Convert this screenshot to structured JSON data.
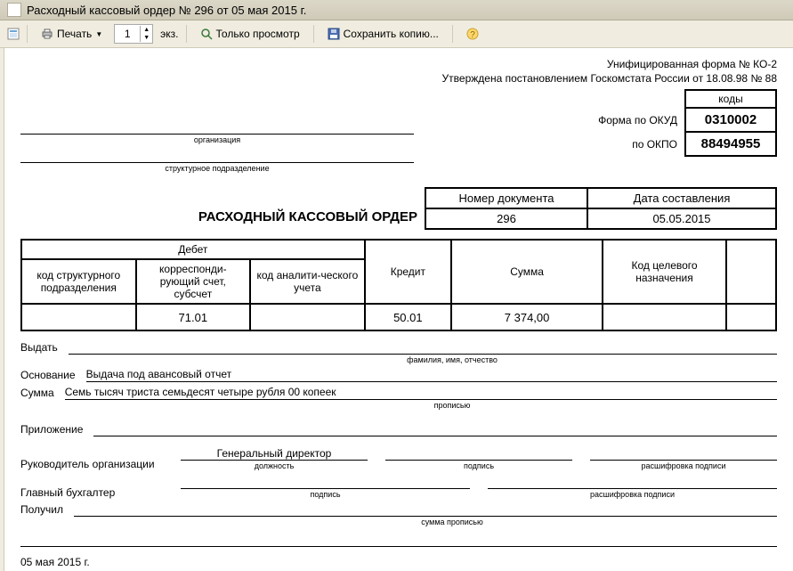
{
  "window": {
    "title": "Расходный кассовый ордер № 296 от 05 мая 2015 г."
  },
  "toolbar": {
    "print": "Печать",
    "copies_value": "1",
    "copies_label": "экз.",
    "preview_only": "Только просмотр",
    "save_copy": "Сохранить копию...",
    "help": "?"
  },
  "header": {
    "form_line1": "Унифицированная форма № КО-2",
    "form_line2": "Утверждена постановлением Госкомстата России от 18.08.98 № 88",
    "codes_label": "коды",
    "okud_label": "Форма по ОКУД",
    "okud_value": "0310002",
    "okpo_label": "по ОКПО",
    "okpo_value": "88494955",
    "org_sub": "организация",
    "org_value": "",
    "dept_sub": "структурное подразделение",
    "dept_value": ""
  },
  "doc": {
    "title": "РАСХОДНЫЙ КАССОВЫЙ ОРДЕР",
    "num_header": "Номер документа",
    "date_header": "Дата составления",
    "number": "296",
    "date": "05.05.2015"
  },
  "table": {
    "debit": "Дебет",
    "code_dept": "код структурного подразделения",
    "corr_acc": "корреспонди-рующий счет, субсчет",
    "anal_code": "код аналити-ческого учета",
    "credit": "Кредит",
    "sum": "Сумма",
    "target_code": "Код целевого назначения",
    "row": {
      "code_dept": "",
      "corr_acc": "71.01",
      "anal_code": "",
      "credit": "50.01",
      "sum": "7 374,00",
      "target_code": "",
      "extra": ""
    }
  },
  "fields": {
    "issue_label": "Выдать",
    "issue_value": "",
    "issue_sub": "фамилия, имя, отчество",
    "basis_label": "Основание",
    "basis_value": "Выдача под авансовый отчет",
    "sum_label": "Сумма",
    "sum_words": "Семь тысяч триста семьдесят четыре рубля 00 копеек",
    "sum_sub": "прописью",
    "attachment_label": "Приложение",
    "attachment_value": "",
    "head_label": "Руководитель организации",
    "head_position": "Генеральный директор",
    "position_sub": "должность",
    "signature_sub": "подпись",
    "decipher_sub": "расшифровка подписи",
    "head_name": "",
    "chief_acc_label": "Главный бухгалтер",
    "chief_acc_name": "",
    "received_label": "Получил",
    "received_sub": "сумма прописью",
    "footer_date": "05 мая 2015 г."
  }
}
